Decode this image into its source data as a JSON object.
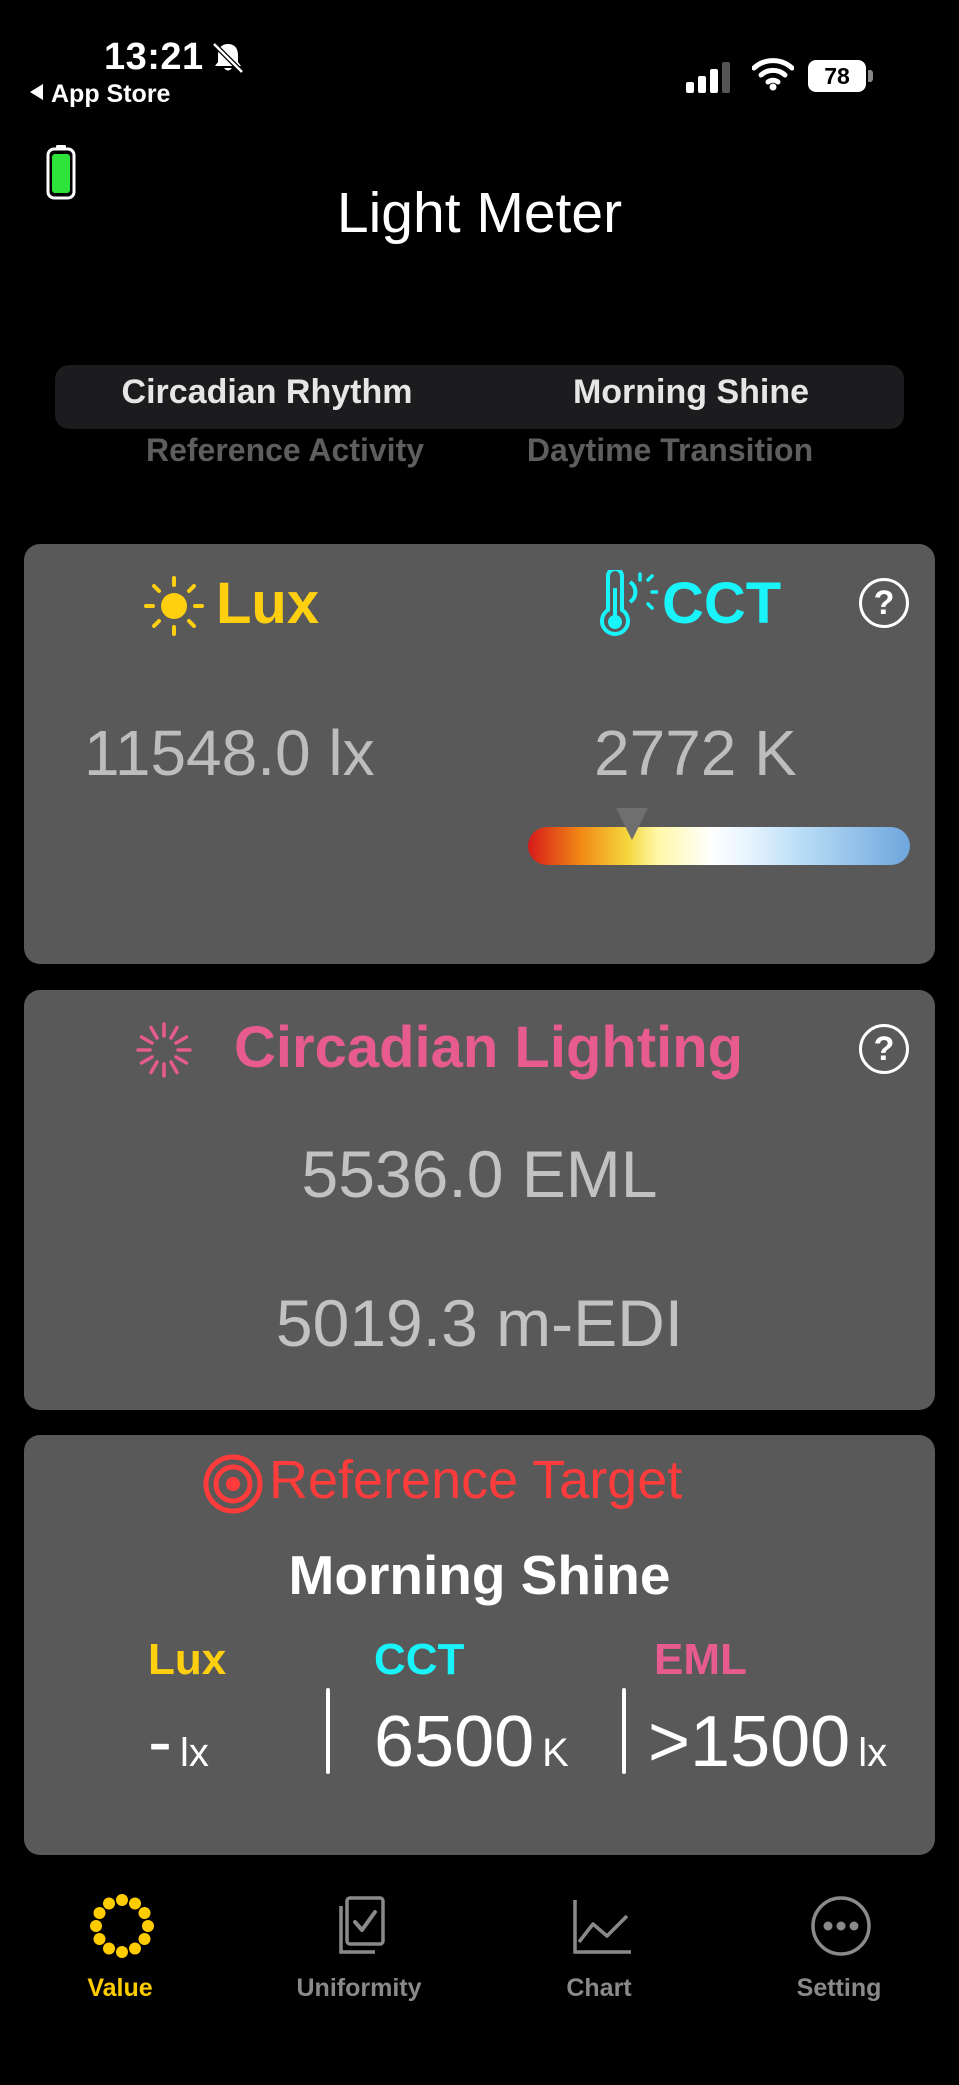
{
  "status_bar": {
    "time": "13:21",
    "back_label": "App Store",
    "battery_percent": "78"
  },
  "title": "Light Meter",
  "segment": {
    "left": "Circadian Rhythm",
    "right": "Morning Shine",
    "sub_left": "Reference Activity",
    "sub_right": "Daytime Transition"
  },
  "measure": {
    "lux_title": "Lux",
    "cct_title": "CCT",
    "lux_value": "11548.0 lx",
    "cct_value": "2772 K",
    "help": "?"
  },
  "circadian": {
    "title": "Circadian Lighting",
    "eml_value": "5536.0 EML",
    "medi_value": "5019.3 m-EDI",
    "help": "?"
  },
  "reference": {
    "title": "Reference Target",
    "mode": "Morning Shine",
    "lux_head": "Lux",
    "cct_head": "CCT",
    "eml_head": "EML",
    "lux_value": "-",
    "lux_unit": "lx",
    "cct_value": "6500",
    "cct_unit": "K",
    "eml_value": ">1500",
    "eml_unit": "lx"
  },
  "tabs": [
    {
      "label": "Value",
      "icon": "sun-ring-icon"
    },
    {
      "label": "Uniformity",
      "icon": "document-check-icon"
    },
    {
      "label": "Chart",
      "icon": "line-chart-icon"
    },
    {
      "label": "Setting",
      "icon": "ellipsis-circle-icon"
    }
  ],
  "colors": {
    "lux": "#ffcf10",
    "cct": "#19f3fa",
    "circadian": "#e75b8e",
    "reference": "#ff3b3b",
    "active_tab": "#ffcc00"
  }
}
